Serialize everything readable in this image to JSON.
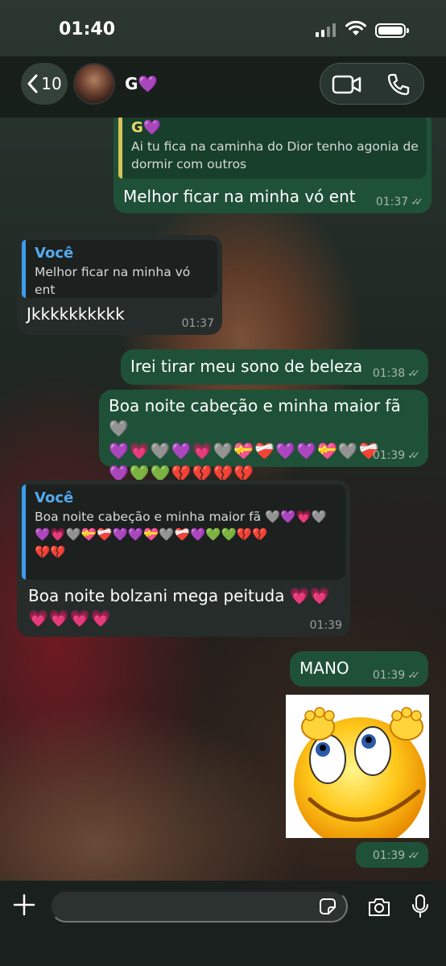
{
  "status": {
    "time": "01:40"
  },
  "header": {
    "back_count": "10",
    "contact_name": "G💜"
  },
  "messages": [
    {
      "quote_author": "G💜",
      "quote_text": "Ai tu fica na caminha do Dior tenho agonia de dormir com outros",
      "text": "Melhor ficar na minha vó ent",
      "time": "01:37"
    },
    {
      "quote_author": "Você",
      "quote_text": "Melhor ficar na minha vó ent",
      "text": "Jkkkkkkkkkk",
      "time": "01:37"
    },
    {
      "text": "Irei tirar meu sono de beleza",
      "time": "01:38"
    },
    {
      "text": "Boa noite cabeção e minha maior fã 🩶",
      "emojis1": "💜💗🩶💜💗🩶💝❤️‍🩹💜💜💝🩶❤️‍🩹",
      "emojis2": "💜💚💚💔💔💔💔",
      "time": "01:39"
    },
    {
      "quote_author": "Você",
      "quote_text": "Boa noite cabeção e minha maior fã 🩶💜💗🩶",
      "quote_text2": "💜💗🩶💝❤️‍🩹💜💜💝🩶❤️‍🩹💜💚💚💔💔",
      "quote_text3": "💔💔",
      "text": "Boa noite bolzani mega peituda 💗💗",
      "emojis1": "💗💗💗💗",
      "time": "01:39"
    },
    {
      "text": "MANO",
      "time": "01:39"
    },
    {
      "time": "01:39"
    }
  ],
  "composer": {
    "placeholder": ""
  }
}
